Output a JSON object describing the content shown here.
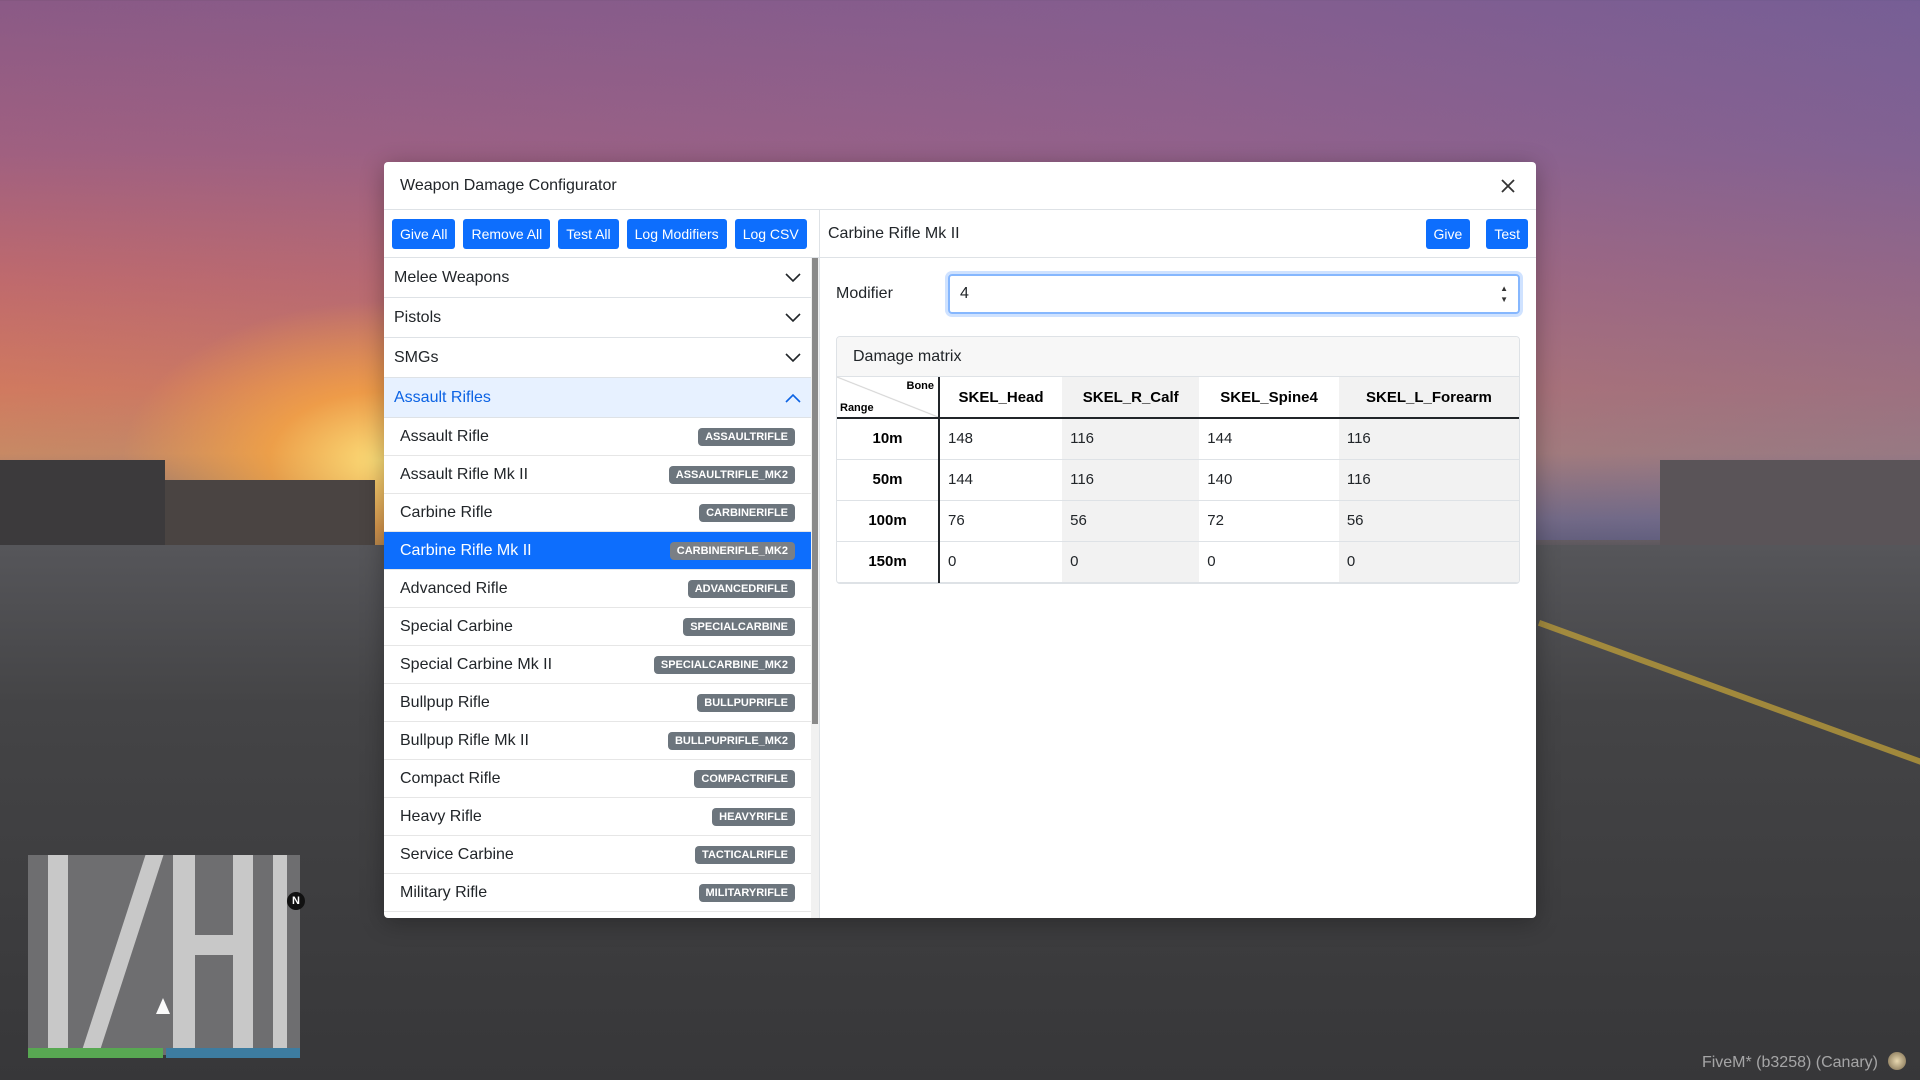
{
  "modal": {
    "title": "Weapon Damage Configurator"
  },
  "toolbar": {
    "give_all": "Give All",
    "remove_all": "Remove All",
    "test_all": "Test All",
    "log_modifiers": "Log Modifiers",
    "log_csv": "Log CSV"
  },
  "categories": [
    {
      "label": "Melee Weapons",
      "open": false
    },
    {
      "label": "Pistols",
      "open": false
    },
    {
      "label": "SMGs",
      "open": false
    },
    {
      "label": "Assault Rifles",
      "open": true
    }
  ],
  "weapons": [
    {
      "name": "Assault Rifle",
      "code": "ASSAULTRIFLE"
    },
    {
      "name": "Assault Rifle Mk II",
      "code": "ASSAULTRIFLE_MK2"
    },
    {
      "name": "Carbine Rifle",
      "code": "CARBINERIFLE"
    },
    {
      "name": "Carbine Rifle Mk II",
      "code": "CARBINERIFLE_MK2",
      "selected": true
    },
    {
      "name": "Advanced Rifle",
      "code": "ADVANCEDRIFLE"
    },
    {
      "name": "Special Carbine",
      "code": "SPECIALCARBINE"
    },
    {
      "name": "Special Carbine Mk II",
      "code": "SPECIALCARBINE_MK2"
    },
    {
      "name": "Bullpup Rifle",
      "code": "BULLPUPRIFLE"
    },
    {
      "name": "Bullpup Rifle Mk II",
      "code": "BULLPUPRIFLE_MK2"
    },
    {
      "name": "Compact Rifle",
      "code": "COMPACTRIFLE"
    },
    {
      "name": "Heavy Rifle",
      "code": "HEAVYRIFLE"
    },
    {
      "name": "Service Carbine",
      "code": "TACTICALRIFLE"
    },
    {
      "name": "Military Rifle",
      "code": "MILITARYRIFLE"
    }
  ],
  "detail": {
    "weapon_title": "Carbine Rifle Mk II",
    "give_label": "Give",
    "test_label": "Test",
    "modifier_label": "Modifier",
    "modifier_value": "4",
    "matrix_title": "Damage matrix",
    "corner_bone": "Bone",
    "corner_range": "Range",
    "bones": [
      "SKEL_Head",
      "SKEL_R_Calf",
      "SKEL_Spine4",
      "SKEL_L_Forearm"
    ],
    "rows": [
      {
        "range": "10m",
        "values": [
          "148",
          "116",
          "144",
          "116"
        ]
      },
      {
        "range": "50m",
        "values": [
          "144",
          "116",
          "140",
          "116"
        ]
      },
      {
        "range": "100m",
        "values": [
          "76",
          "56",
          "72",
          "56"
        ]
      },
      {
        "range": "150m",
        "values": [
          "0",
          "0",
          "0",
          "0"
        ]
      }
    ]
  },
  "hud": {
    "north": "N",
    "client_label": "FiveM* (b3258) (Canary)"
  },
  "colors": {
    "primary": "#0d6efd",
    "badge": "#6c757d",
    "accordion_open_bg": "#e7f1ff"
  }
}
